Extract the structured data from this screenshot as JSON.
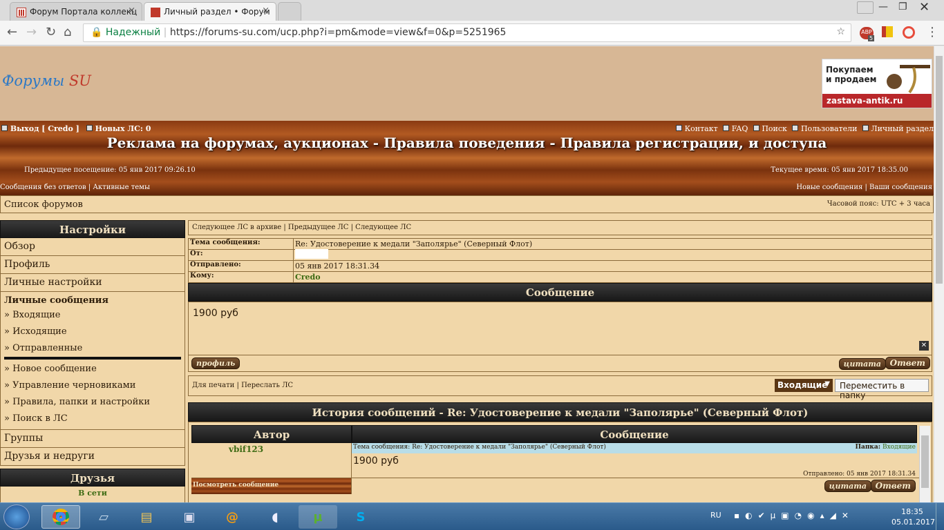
{
  "browser": {
    "tabs": [
      {
        "title": "Форум Портала коллекц"
      },
      {
        "title": "Личный раздел • Форум"
      }
    ],
    "secure_label": "Надежный",
    "url": "https://forums-su.com/ucp.php?i=pm&mode=view&f=0&p=5251965",
    "ext_badge": "5"
  },
  "header": {
    "logo_part1": "Форумы",
    "logo_part2": "SU",
    "ad_line1": "Покупаем",
    "ad_line2": "и продаем",
    "ad_site": "zastava-antik.ru"
  },
  "top": {
    "logout": "Выход [ Credo ]",
    "new_pm": "Новых ЛС: 0",
    "links": [
      "Контакт",
      "FAQ",
      "Поиск",
      "Пользователи",
      "Личный раздел"
    ],
    "site_title": "Реклама на форумах, аукционах - Правила поведения - Правила регистрации, и доступа",
    "last_visit": "Предыдущее посещение: 05 янв 2017 09:26.10",
    "current_time": "Текущее время: 05 янв 2017 18:35.00",
    "left_links": [
      "Сообщения без ответов",
      "Активные темы"
    ],
    "right_links": [
      "Новые сообщения",
      "Ваши сообщения"
    ]
  },
  "crumb": {
    "forum_list": "Список форумов",
    "timezone": "Часовой пояс: UTC + 3 часа"
  },
  "sidebar": {
    "settings_title": "Настройки",
    "items": [
      "Обзор",
      "Профиль",
      "Личные настройки"
    ],
    "pm_title": "Личные сообщения",
    "pm_items": [
      "» Входящие",
      "» Исходящие",
      "» Отправленные"
    ],
    "pm_more": [
      "» Новое сообщение",
      "» Управление черновиками",
      "» Правила, папки и настройки",
      "» Поиск в ЛС"
    ],
    "items2": [
      "Группы",
      "Друзья и недруги"
    ],
    "friends_title": "Друзья",
    "online": "В сети"
  },
  "message": {
    "nav_links": [
      "Следующее ЛС в архиве",
      "Предыдущее ЛС",
      "Следующее ЛС"
    ],
    "subject_label": "Тема сообщения:",
    "subject": "Re: Удостоверение к медали \"Заполярье\" (Северный Флот)",
    "from_label": "От:",
    "sent_label": "Отправлено:",
    "sent": "05 янв 2017 18:31.34",
    "to_label": "Кому:",
    "to": "Credo",
    "section_title": "Сообщение",
    "body": "1900 руб",
    "profile_btn": "профиль",
    "quote_btn": "цитата",
    "reply_btn": "Ответ"
  },
  "actions": {
    "print": "Для печати",
    "forward": "Переслать ЛС",
    "folder": "Входящие",
    "move_btn": "Переместить в папку"
  },
  "history": {
    "title": "История сообщений - Re: Удостоверение к медали \"Заполярье\" (Северный Флот)",
    "col_author": "Автор",
    "col_message": "Сообщение",
    "author": "vbif123",
    "subject_line": "Тема сообщения: Re: Удостоверение к медали \"Заполярье\" (Северный Флот)",
    "folder_label": "Папка:",
    "folder": "Входящие",
    "body": "1900 руб",
    "sent": "Отправлено: 05 янв 2017 18:31.34",
    "view_link": "Посмотреть сообщение",
    "quote_btn": "цитата",
    "reply_btn": "Ответ"
  },
  "taskbar": {
    "lang": "RU",
    "time": "18:35",
    "date": "05.01.2017"
  },
  "colors": {
    "link_green": "#3e6b14",
    "wood_accent": "#8a3a12"
  }
}
